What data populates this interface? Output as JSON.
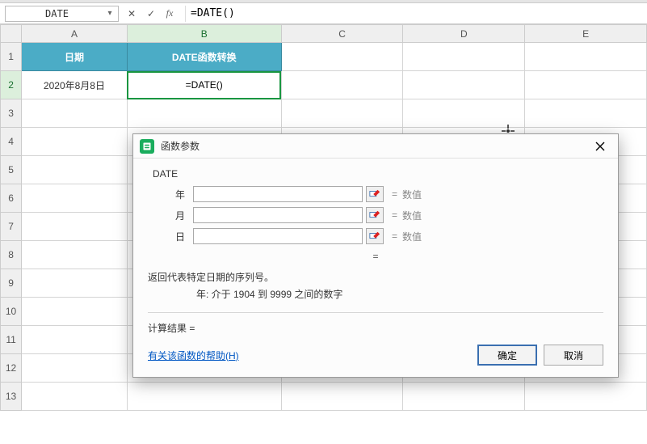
{
  "formula_bar": {
    "name_box": "DATE",
    "cancel_glyph": "✕",
    "confirm_glyph": "✓",
    "fx_label": "fx",
    "formula_text": "=DATE()"
  },
  "columns": [
    "A",
    "B",
    "C",
    "D",
    "E"
  ],
  "rows": [
    "1",
    "2",
    "3",
    "4",
    "5",
    "6",
    "7",
    "8",
    "9",
    "10",
    "11",
    "12",
    "13"
  ],
  "sheet": {
    "A1": "日期",
    "B1": "DATE函数转换",
    "A2": "2020年8月8日",
    "B2": "=DATE()"
  },
  "dialog": {
    "title": "函数参数",
    "func_name": "DATE",
    "params": [
      {
        "label": "年",
        "hint": "数值"
      },
      {
        "label": "月",
        "hint": "数值"
      },
      {
        "label": "日",
        "hint": "数值"
      }
    ],
    "eq_symbol": "=",
    "result_eq": "=",
    "description": "返回代表特定日期的序列号。",
    "arg_description": "年:  介于 1904 到 9999 之间的数字",
    "calc_label": "计算结果 =",
    "help_link": "有关该函数的帮助(H)",
    "ok_label": "确定",
    "cancel_label": "取消"
  }
}
